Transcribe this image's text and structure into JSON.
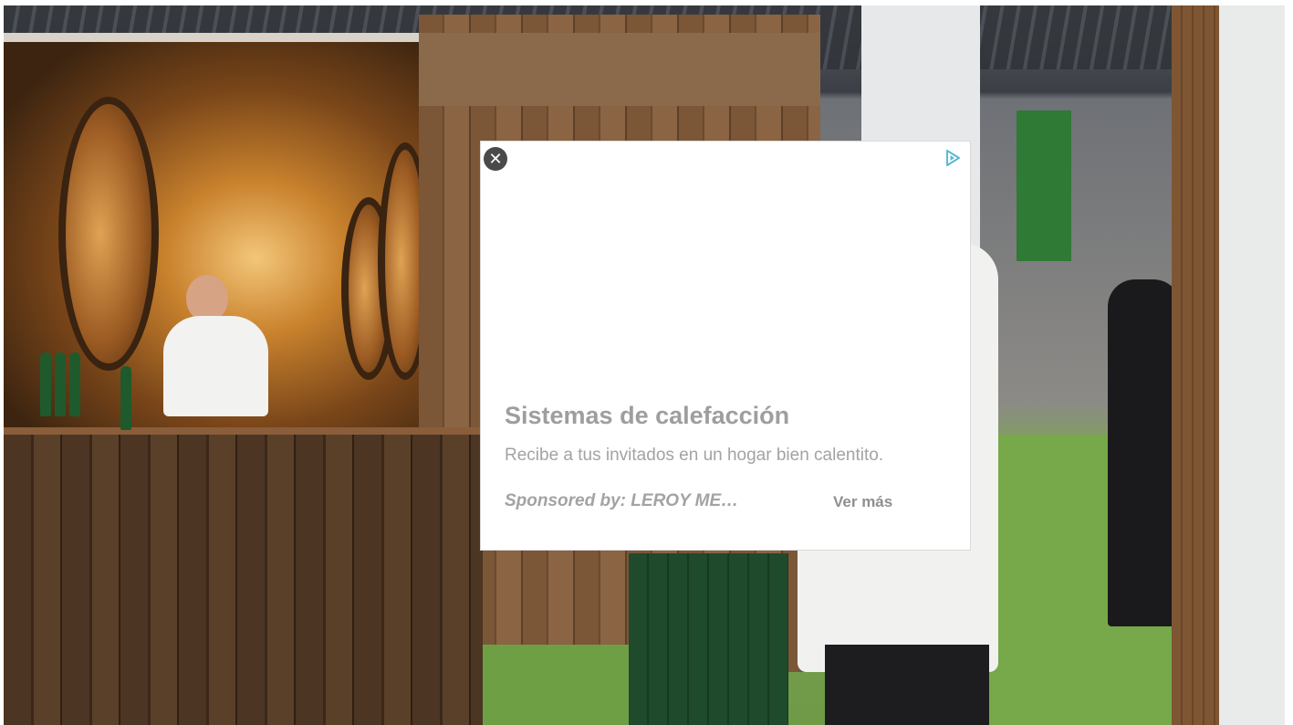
{
  "ad": {
    "title": "Sistemas de calefacción",
    "description": "Recibe a tus invitados en un hogar bien calentito.",
    "sponsor": "Sponsored by: LEROY ME…",
    "cta": "Ver más",
    "close_glyph": "✕",
    "icons": {
      "close": "close-icon",
      "adchoices": "adchoices-icon"
    },
    "colors": {
      "text": "#a3a3a3",
      "close_bg": "#4a4a4a",
      "adchoices": "#5bb8d6"
    }
  }
}
